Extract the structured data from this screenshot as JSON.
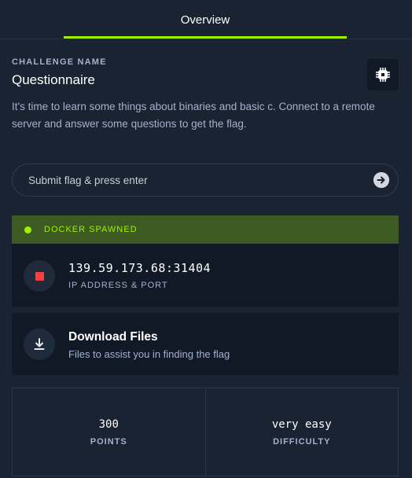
{
  "tabs": [
    {
      "label": "Overview",
      "active": true
    }
  ],
  "challenge": {
    "label": "CHALLENGE NAME",
    "name": "Questionnaire",
    "category_icon": "circuit-chip-icon",
    "description": "It's time to learn some things about binaries and basic c. Connect to a remote server and answer some questions to get the flag."
  },
  "flag_input": {
    "placeholder": "Submit flag & press enter",
    "value": "",
    "submit_icon": "arrow-right-circle-icon"
  },
  "docker": {
    "status": "DOCKER SPAWNED",
    "ip_port": "139.59.173.68:31404",
    "ip_label": "IP ADDRESS & PORT",
    "stop_icon": "stop-icon"
  },
  "download": {
    "title": "Download Files",
    "subtitle": "Files to assist you in finding the flag",
    "icon": "download-icon"
  },
  "stats": [
    {
      "value": "300",
      "label": "POINTS"
    },
    {
      "value": "very easy",
      "label": "DIFFICULTY"
    }
  ],
  "colors": {
    "background": "#1a2332",
    "card": "#111927",
    "accent": "#9fef00",
    "docker_banner": "#3d5a23",
    "stop": "#ff3e3e",
    "muted_text": "#a4b1cd"
  }
}
